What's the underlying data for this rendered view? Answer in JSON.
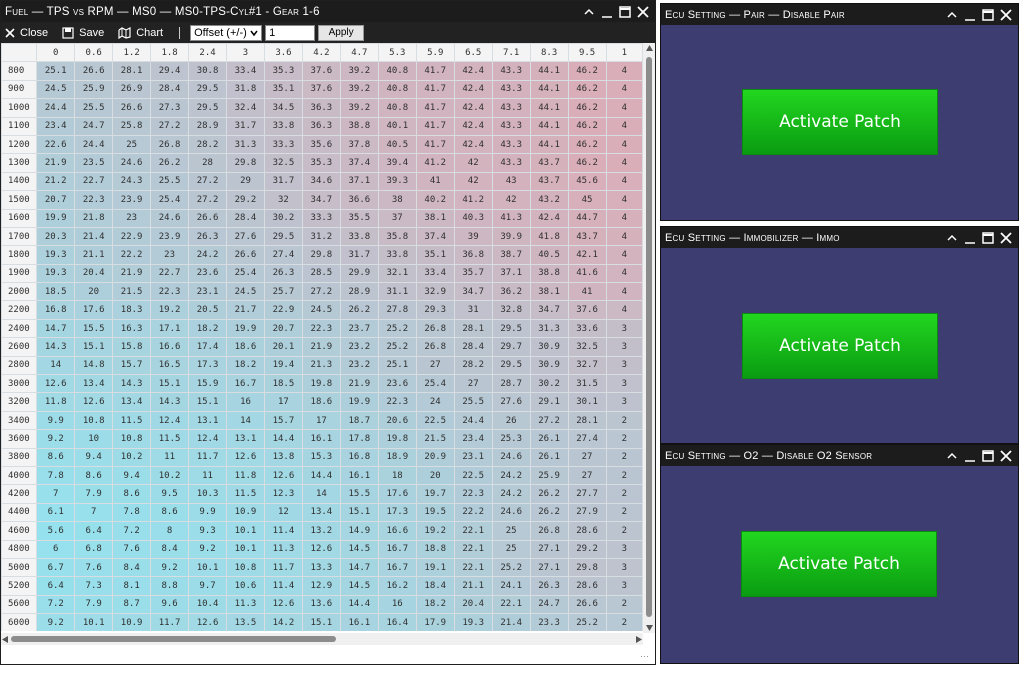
{
  "fuel_window": {
    "title": "Fuel — TPS vs RPM — MS0 — MS0-TPS-Cyl#1 - Gear 1-6",
    "toolbar": {
      "close_label": "Close",
      "save_label": "Save",
      "chart_label": "Chart",
      "mode_select": "Offset (+/-)",
      "value_input": "1",
      "apply_label": "Apply"
    },
    "columns": [
      "0",
      "0.6",
      "1.2",
      "1.8",
      "2.4",
      "3",
      "3.6",
      "4.2",
      "4.7",
      "5.3",
      "5.9",
      "6.5",
      "7.1",
      "8.3",
      "9.5",
      "1"
    ],
    "rows": [
      {
        "rpm": "800",
        "v": [
          "25.1",
          "26.6",
          "28.1",
          "29.4",
          "30.8",
          "33.4",
          "35.3",
          "37.6",
          "39.2",
          "40.8",
          "41.7",
          "42.4",
          "43.3",
          "44.1",
          "46.2",
          "4"
        ]
      },
      {
        "rpm": "900",
        "v": [
          "24.5",
          "25.9",
          "26.9",
          "28.4",
          "29.5",
          "31.8",
          "35.1",
          "37.6",
          "39.2",
          "40.8",
          "41.7",
          "42.4",
          "43.3",
          "44.1",
          "46.2",
          "4"
        ]
      },
      {
        "rpm": "1000",
        "v": [
          "24.4",
          "25.5",
          "26.6",
          "27.3",
          "29.5",
          "32.4",
          "34.5",
          "36.3",
          "39.2",
          "40.8",
          "41.7",
          "42.4",
          "43.3",
          "44.1",
          "46.2",
          "4"
        ]
      },
      {
        "rpm": "1100",
        "v": [
          "23.4",
          "24.7",
          "25.8",
          "27.2",
          "28.9",
          "31.7",
          "33.8",
          "36.3",
          "38.8",
          "40.1",
          "41.7",
          "42.4",
          "43.3",
          "44.1",
          "46.2",
          "4"
        ]
      },
      {
        "rpm": "1200",
        "v": [
          "22.6",
          "24.4",
          "25",
          "26.8",
          "28.2",
          "31.3",
          "33.3",
          "35.6",
          "37.8",
          "40.5",
          "41.7",
          "42.4",
          "43.3",
          "44.1",
          "46.2",
          "4"
        ]
      },
      {
        "rpm": "1300",
        "v": [
          "21.9",
          "23.5",
          "24.6",
          "26.2",
          "28",
          "29.8",
          "32.5",
          "35.3",
          "37.4",
          "39.4",
          "41.2",
          "42",
          "43.3",
          "43.7",
          "46.2",
          "4"
        ]
      },
      {
        "rpm": "1400",
        "v": [
          "21.2",
          "22.7",
          "24.3",
          "25.5",
          "27.2",
          "29",
          "31.7",
          "34.6",
          "37.1",
          "39.3",
          "41",
          "42",
          "43",
          "43.7",
          "45.6",
          "4"
        ]
      },
      {
        "rpm": "1500",
        "v": [
          "20.7",
          "22.3",
          "23.9",
          "25.4",
          "27.2",
          "29.2",
          "32",
          "34.7",
          "36.6",
          "38",
          "40.2",
          "41.2",
          "42",
          "43.2",
          "45",
          "4"
        ]
      },
      {
        "rpm": "1600",
        "v": [
          "19.9",
          "21.8",
          "23",
          "24.6",
          "26.6",
          "28.4",
          "30.2",
          "33.3",
          "35.5",
          "37",
          "38.1",
          "40.3",
          "41.3",
          "42.4",
          "44.7",
          "4"
        ]
      },
      {
        "rpm": "1700",
        "v": [
          "20.3",
          "21.4",
          "22.9",
          "23.9",
          "26.3",
          "27.6",
          "29.5",
          "31.2",
          "33.8",
          "35.8",
          "37.4",
          "39",
          "39.9",
          "41.8",
          "43.7",
          "4"
        ]
      },
      {
        "rpm": "1800",
        "v": [
          "19.3",
          "21.1",
          "22.2",
          "23",
          "24.2",
          "26.6",
          "27.4",
          "29.8",
          "31.7",
          "33.8",
          "35.1",
          "36.8",
          "38.7",
          "40.5",
          "42.1",
          "4"
        ]
      },
      {
        "rpm": "1900",
        "v": [
          "19.3",
          "20.4",
          "21.9",
          "22.7",
          "23.6",
          "25.4",
          "26.3",
          "28.5",
          "29.9",
          "32.1",
          "33.4",
          "35.7",
          "37.1",
          "38.8",
          "41.6",
          "4"
        ]
      },
      {
        "rpm": "2000",
        "v": [
          "18.5",
          "20",
          "21.5",
          "22.3",
          "23.1",
          "24.5",
          "25.7",
          "27.2",
          "28.9",
          "31.1",
          "32.9",
          "34.7",
          "36.2",
          "38.1",
          "41",
          "4"
        ]
      },
      {
        "rpm": "2200",
        "v": [
          "16.8",
          "17.6",
          "18.3",
          "19.2",
          "20.5",
          "21.7",
          "22.9",
          "24.5",
          "26.2",
          "27.8",
          "29.3",
          "31",
          "32.8",
          "34.7",
          "37.6",
          "4"
        ]
      },
      {
        "rpm": "2400",
        "v": [
          "14.7",
          "15.5",
          "16.3",
          "17.1",
          "18.2",
          "19.9",
          "20.7",
          "22.3",
          "23.7",
          "25.2",
          "26.8",
          "28.1",
          "29.5",
          "31.3",
          "33.6",
          "3"
        ]
      },
      {
        "rpm": "2600",
        "v": [
          "14.3",
          "15.1",
          "15.8",
          "16.6",
          "17.4",
          "18.6",
          "20.1",
          "21.9",
          "23.2",
          "25.2",
          "26.8",
          "28.4",
          "29.7",
          "30.9",
          "32.5",
          "3"
        ]
      },
      {
        "rpm": "2800",
        "v": [
          "14",
          "14.8",
          "15.7",
          "16.5",
          "17.3",
          "18.2",
          "19.4",
          "21.3",
          "23.2",
          "25.1",
          "27",
          "28.2",
          "29.5",
          "30.9",
          "32.7",
          "3"
        ]
      },
      {
        "rpm": "3000",
        "v": [
          "12.6",
          "13.4",
          "14.3",
          "15.1",
          "15.9",
          "16.7",
          "18.5",
          "19.8",
          "21.9",
          "23.6",
          "25.4",
          "27",
          "28.7",
          "30.2",
          "31.5",
          "3"
        ]
      },
      {
        "rpm": "3200",
        "v": [
          "11.8",
          "12.6",
          "13.4",
          "14.3",
          "15.1",
          "16",
          "17",
          "18.6",
          "19.9",
          "22.3",
          "24",
          "25.5",
          "27.6",
          "29.1",
          "30.1",
          "3"
        ]
      },
      {
        "rpm": "3400",
        "v": [
          "9.9",
          "10.8",
          "11.5",
          "12.4",
          "13.1",
          "14",
          "15.7",
          "17",
          "18.7",
          "20.6",
          "22.5",
          "24.4",
          "26",
          "27.2",
          "28.1",
          "2"
        ]
      },
      {
        "rpm": "3600",
        "v": [
          "9.2",
          "10",
          "10.8",
          "11.5",
          "12.4",
          "13.1",
          "14.4",
          "16.1",
          "17.8",
          "19.8",
          "21.5",
          "23.4",
          "25.3",
          "26.1",
          "27.4",
          "2"
        ]
      },
      {
        "rpm": "3800",
        "v": [
          "8.6",
          "9.4",
          "10.2",
          "11",
          "11.7",
          "12.6",
          "13.8",
          "15.3",
          "16.8",
          "18.9",
          "20.9",
          "23.1",
          "24.6",
          "26.1",
          "27",
          "2"
        ]
      },
      {
        "rpm": "4000",
        "v": [
          "7.8",
          "8.6",
          "9.4",
          "10.2",
          "11",
          "11.8",
          "12.6",
          "14.4",
          "16.1",
          "18",
          "20",
          "22.5",
          "24.2",
          "25.9",
          "27",
          "2"
        ]
      },
      {
        "rpm": "4200",
        "v": [
          "7",
          "7.9",
          "8.6",
          "9.5",
          "10.3",
          "11.5",
          "12.3",
          "14",
          "15.5",
          "17.6",
          "19.7",
          "22.3",
          "24.2",
          "26.2",
          "27.7",
          "2"
        ]
      },
      {
        "rpm": "4400",
        "v": [
          "6.1",
          "7",
          "7.8",
          "8.6",
          "9.9",
          "10.9",
          "12",
          "13.4",
          "15.1",
          "17.3",
          "19.5",
          "22.2",
          "24.6",
          "26.2",
          "27.9",
          "2"
        ]
      },
      {
        "rpm": "4600",
        "v": [
          "5.6",
          "6.4",
          "7.2",
          "8",
          "9.3",
          "10.1",
          "11.4",
          "13.2",
          "14.9",
          "16.6",
          "19.2",
          "22.1",
          "25",
          "26.8",
          "28.6",
          "2"
        ]
      },
      {
        "rpm": "4800",
        "v": [
          "6",
          "6.8",
          "7.6",
          "8.4",
          "9.2",
          "10.1",
          "11.3",
          "12.6",
          "14.5",
          "16.7",
          "18.8",
          "22.1",
          "25",
          "27.1",
          "29.2",
          "3"
        ]
      },
      {
        "rpm": "5000",
        "v": [
          "6.7",
          "7.6",
          "8.4",
          "9.2",
          "10.1",
          "10.8",
          "11.7",
          "13.3",
          "14.7",
          "16.7",
          "19.1",
          "22.1",
          "25.2",
          "27.1",
          "29.8",
          "3"
        ]
      },
      {
        "rpm": "5200",
        "v": [
          "6.4",
          "7.3",
          "8.1",
          "8.8",
          "9.7",
          "10.6",
          "11.4",
          "12.9",
          "14.5",
          "16.2",
          "18.4",
          "21.1",
          "24.1",
          "26.3",
          "28.6",
          "3"
        ]
      },
      {
        "rpm": "5600",
        "v": [
          "7.2",
          "7.9",
          "8.7",
          "9.6",
          "10.4",
          "11.3",
          "12.6",
          "13.6",
          "14.4",
          "16",
          "18.2",
          "20.4",
          "22.1",
          "24.7",
          "26.6",
          "2"
        ]
      },
      {
        "rpm": "6000",
        "v": [
          "9.2",
          "10.1",
          "10.9",
          "11.7",
          "12.6",
          "13.5",
          "14.2",
          "15.1",
          "16.1",
          "16.4",
          "17.9",
          "19.3",
          "21.4",
          "23.3",
          "25.2",
          "2"
        ]
      }
    ]
  },
  "patch_windows": [
    {
      "title": "Ecu Setting — Pair — Disable Pair",
      "button": "Activate Patch"
    },
    {
      "title": "Ecu Setting — Immobilizer — Immo",
      "button": "Activate Patch"
    },
    {
      "title": "Ecu Setting — O2 — Disable O2 Sensor",
      "button": "Activate Patch"
    }
  ],
  "colors": {
    "titlebar": "#1c1c1c",
    "patch_bg": "#3d3d72",
    "patch_button": "#16b81a",
    "cell_low": "#8fe6f2",
    "cell_high": "#d9aeb9"
  }
}
